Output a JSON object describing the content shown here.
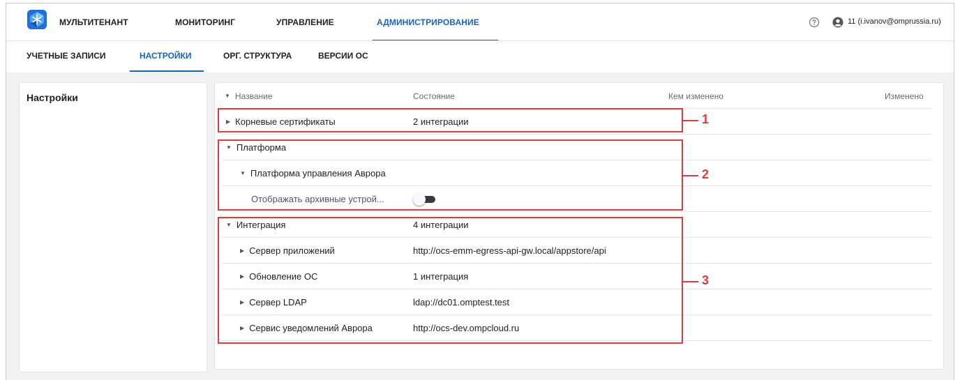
{
  "topnav": {
    "items": [
      {
        "label": "МУЛЬТИТЕНАНТ",
        "active": false
      },
      {
        "label": "МОНИТОРИНГ",
        "active": false
      },
      {
        "label": "УПРАВЛЕНИЕ",
        "active": false
      },
      {
        "label": "АДМИНИСТРИРОВАНИЕ",
        "active": true
      }
    ],
    "help_icon": "help-circle-icon",
    "user_icon": "user-circle-icon",
    "user_label": "11 (i.ivanov@omprussia.ru)"
  },
  "subnav": {
    "tabs": [
      {
        "label": "УЧЕТНЫЕ ЗАПИСИ",
        "active": false
      },
      {
        "label": "НАСТРОЙКИ",
        "active": true
      },
      {
        "label": "ОРГ. СТРУКТУРА",
        "active": false
      },
      {
        "label": "ВЕРСИИ ОС",
        "active": false
      }
    ]
  },
  "sidebar": {
    "title": "Настройки"
  },
  "table": {
    "columns": [
      "Название",
      "Состояние",
      "Кем изменено",
      "Изменено"
    ],
    "rows": [
      {
        "name": "Корневые сертификаты",
        "state": "2 интеграции",
        "level": 0,
        "expanded": false
      },
      {
        "name": "Платформа",
        "state": "",
        "level": 0,
        "expanded": true
      },
      {
        "name": "Платформа управления Аврора",
        "state": "",
        "level": 1,
        "expanded": true
      },
      {
        "name": "Отображать архивные устрой...",
        "state": "",
        "level": 2,
        "toggle": false
      },
      {
        "name": "Интеграция",
        "state": "4 интеграции",
        "level": 0,
        "expanded": true
      },
      {
        "name": "Сервер приложений",
        "state": "http://ocs-emm-egress-api-gw.local/appstore/api",
        "level": 1,
        "expanded": false
      },
      {
        "name": "Обновление ОС",
        "state": "1 интеграция",
        "level": 1,
        "expanded": false
      },
      {
        "name": "Сервер LDAP",
        "state": "ldap://dc01.omptest.test",
        "level": 1,
        "expanded": false
      },
      {
        "name": "Сервис уведомлений Аврора",
        "state": "http://ocs-dev.ompcloud.ru",
        "level": 1,
        "expanded": false
      }
    ]
  },
  "callouts": [
    "1",
    "2",
    "3"
  ],
  "colors": {
    "accent": "#1565c0",
    "annotation": "#e03a3e",
    "brand": "#1e6fd9"
  }
}
